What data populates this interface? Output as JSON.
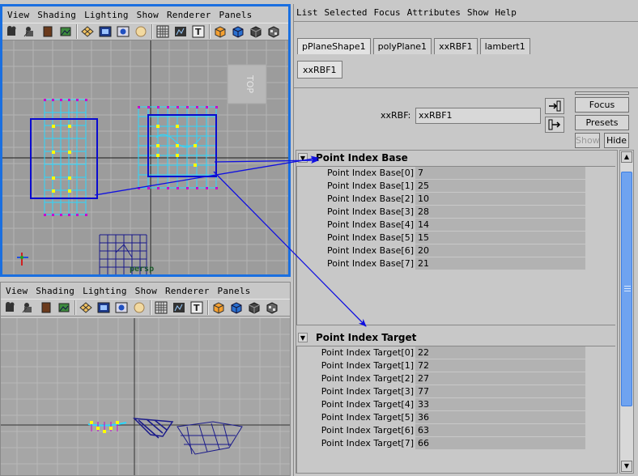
{
  "viewport_menu": [
    "View",
    "Shading",
    "Lighting",
    "Show",
    "Renderer",
    "Panels"
  ],
  "top_view": {
    "cube_label": "TOP",
    "camera_label": "persp"
  },
  "ae_menu": [
    "List",
    "Selected",
    "Focus",
    "Attributes",
    "Show",
    "Help"
  ],
  "tabs": [
    {
      "label": "pPlaneShape1",
      "active": true
    },
    {
      "label": "polyPlane1",
      "active": false
    },
    {
      "label": "xxRBF1",
      "active": false
    },
    {
      "label": "lambert1",
      "active": false
    }
  ],
  "subtab": "xxRBF1",
  "node_field": {
    "label": "xxRBF:",
    "value": "xxRBF1"
  },
  "buttons": {
    "focus": "Focus",
    "presets": "Presets",
    "show": "Show",
    "hide": "Hide"
  },
  "sections": [
    {
      "title": "Point Index Base",
      "rows": [
        {
          "label": "Point Index Base[0]",
          "value": "7"
        },
        {
          "label": "Point Index Base[1]",
          "value": "25"
        },
        {
          "label": "Point Index Base[2]",
          "value": "10"
        },
        {
          "label": "Point Index Base[3]",
          "value": "28"
        },
        {
          "label": "Point Index Base[4]",
          "value": "14"
        },
        {
          "label": "Point Index Base[5]",
          "value": "15"
        },
        {
          "label": "Point Index Base[6]",
          "value": "20"
        },
        {
          "label": "Point Index Base[7]",
          "value": "21"
        }
      ]
    },
    {
      "title": "Point Index Target",
      "rows": [
        {
          "label": "Point Index Target[0]",
          "value": "22"
        },
        {
          "label": "Point Index Target[1]",
          "value": "72"
        },
        {
          "label": "Point Index Target[2]",
          "value": "27"
        },
        {
          "label": "Point Index Target[3]",
          "value": "77"
        },
        {
          "label": "Point Index Target[4]",
          "value": "33"
        },
        {
          "label": "Point Index Target[5]",
          "value": "36"
        },
        {
          "label": "Point Index Target[6]",
          "value": "63"
        },
        {
          "label": "Point Index Target[7]",
          "value": "66"
        }
      ]
    }
  ],
  "colors": {
    "active_panel_border": "#1a6fe0",
    "annotation_arrow": "#1010e0",
    "selection_box": "#0a0ad0",
    "vertex_selected": "#ffff00",
    "vertex_unselected": "#cc00cc",
    "mesh_wire": "#2ad8ff"
  }
}
